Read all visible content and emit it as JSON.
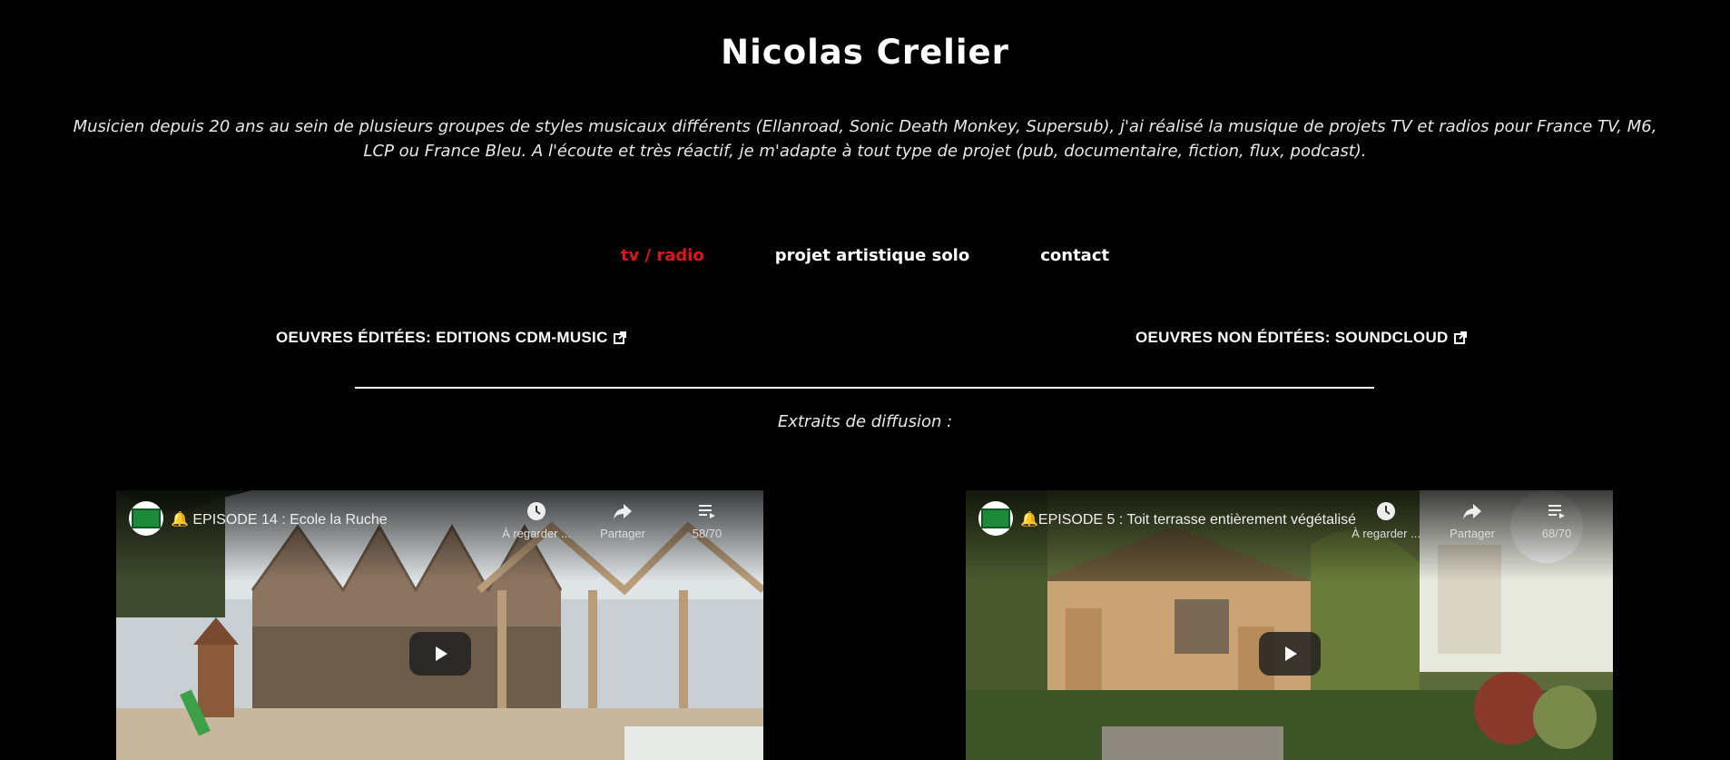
{
  "header": {
    "title": "Nicolas Crelier",
    "intro": "Musicien depuis 20 ans au sein de plusieurs groupes de styles musicaux différents (Ellanroad, Sonic Death Monkey, Supersub), j'ai réalisé la musique de projets TV et radios pour France TV, M6, LCP ou France Bleu. A l'écoute et très réactif, je m'adapte à tout type de projet (pub, documentaire, fiction, flux, podcast)."
  },
  "nav": {
    "items": [
      {
        "label": "tv / radio",
        "active": true
      },
      {
        "label": "projet artistique solo",
        "active": false
      },
      {
        "label": "contact",
        "active": false
      }
    ]
  },
  "links": {
    "edited": "OEUVRES ÉDITÉES: EDITIONS CDM-MUSIC",
    "unedited": "OEUVRES NON ÉDITÉES: SOUNDCLOUD"
  },
  "section": {
    "excerpts_label": "Extraits de diffusion :"
  },
  "videos": [
    {
      "title": "🔔 EPISODE 14 : Ecole la Ruche",
      "watch_later": "À regarder ...",
      "share": "Partager",
      "playlist_count": "58/70"
    },
    {
      "title": "🔔EPISODE 5 : Toit terrasse entièrement végétalisé",
      "watch_later": "À regarder ...",
      "share": "Partager",
      "playlist_count": "68/70"
    }
  ],
  "colors": {
    "active_nav": "#e0141b",
    "background": "#000000"
  }
}
